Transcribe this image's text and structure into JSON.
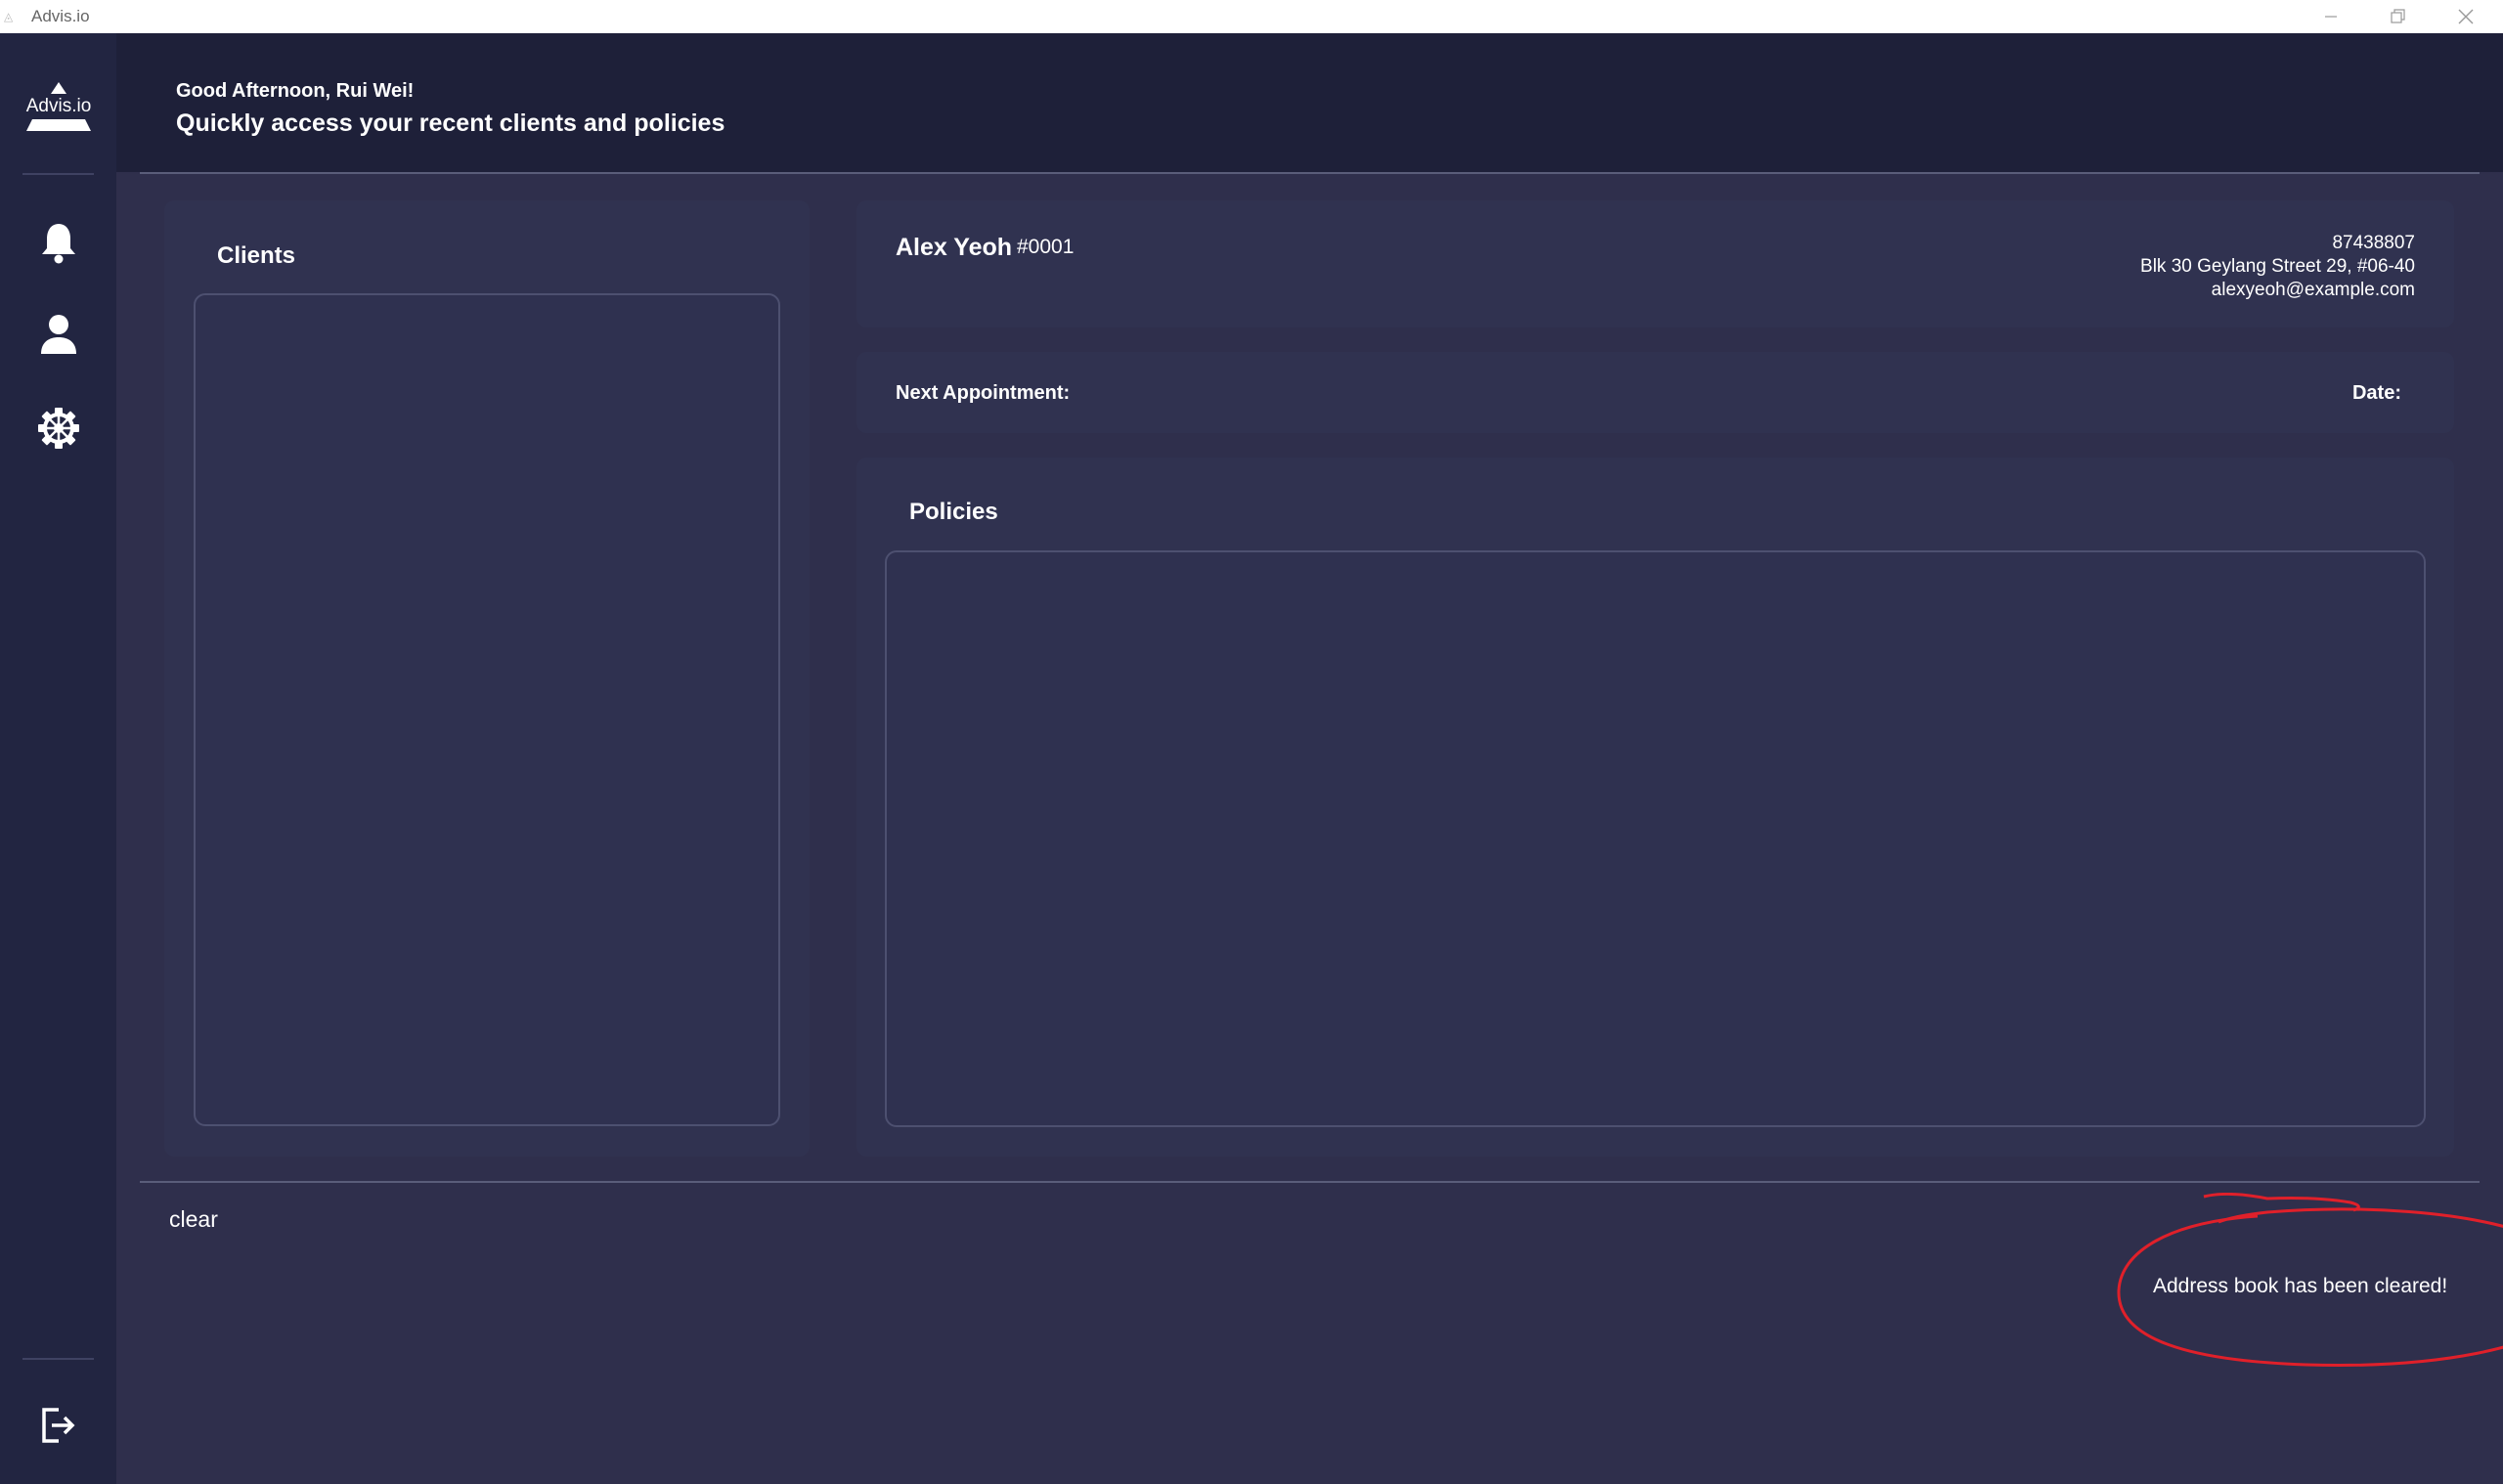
{
  "window": {
    "title": "Advis.io",
    "minimize_icon": "minimize-icon",
    "restore_icon": "restore-icon",
    "close_icon": "close-icon"
  },
  "sidebar": {
    "logo_text": "Advis.io",
    "items": [
      {
        "icon": "bell-icon"
      },
      {
        "icon": "user-icon"
      },
      {
        "icon": "gear-icon"
      }
    ],
    "logout_icon": "logout-icon"
  },
  "header": {
    "greeting": "Good Afternoon, Rui Wei!",
    "subtitle": "Quickly access your recent clients and policies"
  },
  "clients_panel": {
    "title": "Clients"
  },
  "client_card": {
    "name": "Alex Yeoh",
    "id": "#0001",
    "phone": "87438807",
    "address": "Blk 30 Geylang Street 29, #06-40",
    "email": "alexyeoh@example.com"
  },
  "appointment": {
    "label": "Next Appointment:",
    "date_label": "Date:"
  },
  "policies_panel": {
    "title": "Policies"
  },
  "command": {
    "input_value": "clear",
    "result": "Address book has been cleared!"
  },
  "colors": {
    "sidebar": "#222541",
    "header": "#1e2039",
    "background": "#2f2f4c",
    "card": "#303250",
    "annotation": "#e0202a"
  }
}
